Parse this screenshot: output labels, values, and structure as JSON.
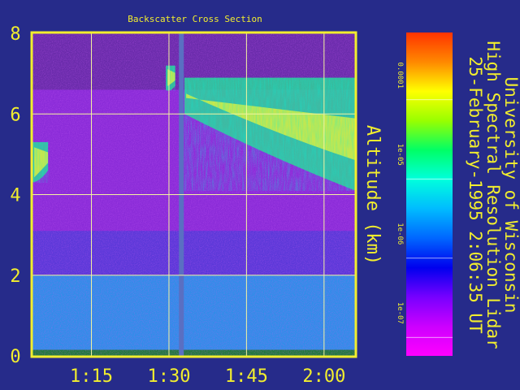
{
  "chart_data": {
    "type": "heatmap",
    "title": "Backscatter Cross Section",
    "ylabel": "Altitude (km)",
    "ylim": [
      0,
      8
    ],
    "yticks": [
      "0",
      "2",
      "4",
      "6",
      "8"
    ],
    "xticks": [
      "1:15",
      "1:30",
      "1:45",
      "2:00"
    ],
    "x_tick_hours": [
      1.25,
      1.5,
      1.75,
      2.0
    ],
    "xlim_hours": [
      1.06,
      2.1
    ],
    "grid": true,
    "colorbar": {
      "ticks": [
        "0.0001",
        "1e-05",
        "1e-06",
        "1e-07"
      ],
      "scale": "log",
      "colors": [
        "#ff3300",
        "#ff8800",
        "#ffff00",
        "#99ff00",
        "#00ff66",
        "#00ffdd",
        "#00bbff",
        "#0066ff",
        "#0000ee",
        "#7700ff",
        "#cc00ff",
        "#ff00ff"
      ]
    },
    "data_gap_hours": 1.54,
    "features": [
      {
        "x_start": 1.55,
        "x_end": 2.1,
        "y_top": 6.9,
        "y_bottom_start": 6.0,
        "y_bottom_end": 4.1
      },
      {
        "x_start": 1.06,
        "x_end": 1.11,
        "y_top": 5.3,
        "y_bottom_start": 4.3,
        "y_bottom_end": 4.6
      },
      {
        "x_start": 1.49,
        "x_end": 1.52,
        "y_top": 7.2,
        "y_bottom_start": 6.6,
        "y_bottom_end": 6.7
      }
    ],
    "boundary_layer_top_km": 2.0
  },
  "sidebar": {
    "line1": "University of Wisconsin",
    "line2": "High Spectral Resolution Lidar",
    "line3": "25-February-1995  2:06:35 UT"
  },
  "colors": {
    "background": "#262b8a",
    "frame": "#f2ee2e",
    "grid": "#f4f4a0",
    "gap": "#5a6fc2"
  }
}
